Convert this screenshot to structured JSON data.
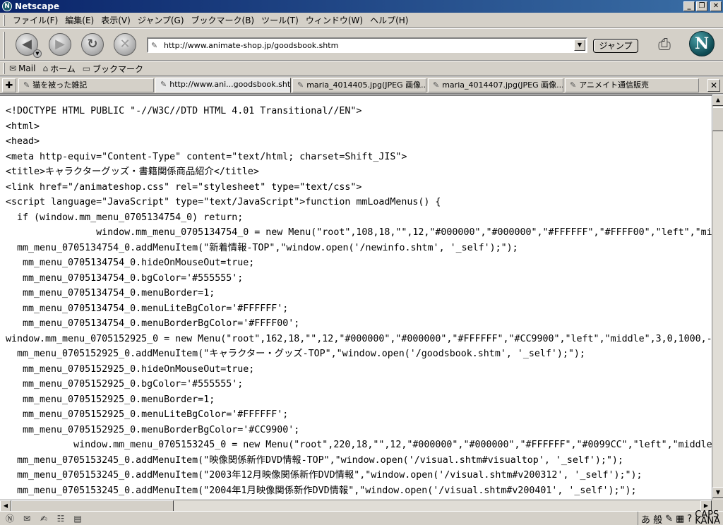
{
  "window": {
    "title": "Netscape"
  },
  "menu": [
    "ファイル(F)",
    "編集(E)",
    "表示(V)",
    "ジャンプ(G)",
    "ブックマーク(B)",
    "ツール(T)",
    "ウィンドウ(W)",
    "ヘルプ(H)"
  ],
  "nav": {
    "url": "http://www.animate-shop.jp/goodsbook.shtm",
    "go_label": "ジャンプ"
  },
  "personal_toolbar": {
    "mail": "Mail",
    "home": "ホーム",
    "bookmarks": "ブックマーク"
  },
  "tabs": [
    "猫を被った雑記",
    "http://www.ani...goodsbook.shtm",
    "maria_4014405.jpg(JPEG 画像...",
    "maria_4014407.jpg(JPEG 画像...",
    "アニメイト通信販売"
  ],
  "active_tab": 1,
  "source_lines": [
    "<!DOCTYPE HTML PUBLIC \"-//W3C//DTD HTML 4.01 Transitional//EN\">",
    "<html>",
    "<head>",
    "<meta http-equiv=\"Content-Type\" content=\"text/html; charset=Shift_JIS\">",
    "<title>キャラクターグッズ・書籍関係商品紹介</title>",
    "<link href=\"/animateshop.css\" rel=\"stylesheet\" type=\"text/css\">",
    "<script language=\"JavaScript\" type=\"text/JavaScript\">function mmLoadMenus() {",
    "  if (window.mm_menu_0705134754_0) return;",
    "                window.mm_menu_0705134754_0 = new Menu(\"root\",108,18,\"\",12,\"#000000\",\"#000000\",\"#FFFFFF\",\"#FFFF00\",\"left\",\"mi",
    "  mm_menu_0705134754_0.addMenuItem(\"新着情報-TOP\",\"window.open('/newinfo.shtm', '_self');\");",
    "   mm_menu_0705134754_0.hideOnMouseOut=true;",
    "   mm_menu_0705134754_0.bgColor='#555555';",
    "   mm_menu_0705134754_0.menuBorder=1;",
    "   mm_menu_0705134754_0.menuLiteBgColor='#FFFFFF';",
    "   mm_menu_0705134754_0.menuBorderBgColor='#FFFF00';",
    "window.mm_menu_0705152925_0 = new Menu(\"root\",162,18,\"\",12,\"#000000\",\"#000000\",\"#FFFFFF\",\"#CC9900\",\"left\",\"middle\",3,0,1000,-",
    "  mm_menu_0705152925_0.addMenuItem(\"キャラクター・グッズ-TOP\",\"window.open('/goodsbook.shtm', '_self');\");",
    "   mm_menu_0705152925_0.hideOnMouseOut=true;",
    "   mm_menu_0705152925_0.bgColor='#555555';",
    "   mm_menu_0705152925_0.menuBorder=1;",
    "   mm_menu_0705152925_0.menuLiteBgColor='#FFFFFF';",
    "   mm_menu_0705152925_0.menuBorderBgColor='#CC9900';",
    "            window.mm_menu_0705153245_0 = new Menu(\"root\",220,18,\"\",12,\"#000000\",\"#000000\",\"#FFFFFF\",\"#0099CC\",\"left\",\"middle",
    "  mm_menu_0705153245_0.addMenuItem(\"映像関係新作DVD情報-TOP\",\"window.open('/visual.shtm#visualtop', '_self');\");",
    "  mm_menu_0705153245_0.addMenuItem(\"2003年12月映像関係新作DVD情報\",\"window.open('/visual.shtm#v200312', '_self');\");",
    "  mm_menu_0705153245_0.addMenuItem(\"2004年1月映像関係新作DVD情報\",\"window.open('/visual.shtm#v200401', '_self');\");"
  ],
  "ime": {
    "mode1": "あ",
    "mode2": "般",
    "caps": "CAPS",
    "kana": "KANA"
  }
}
